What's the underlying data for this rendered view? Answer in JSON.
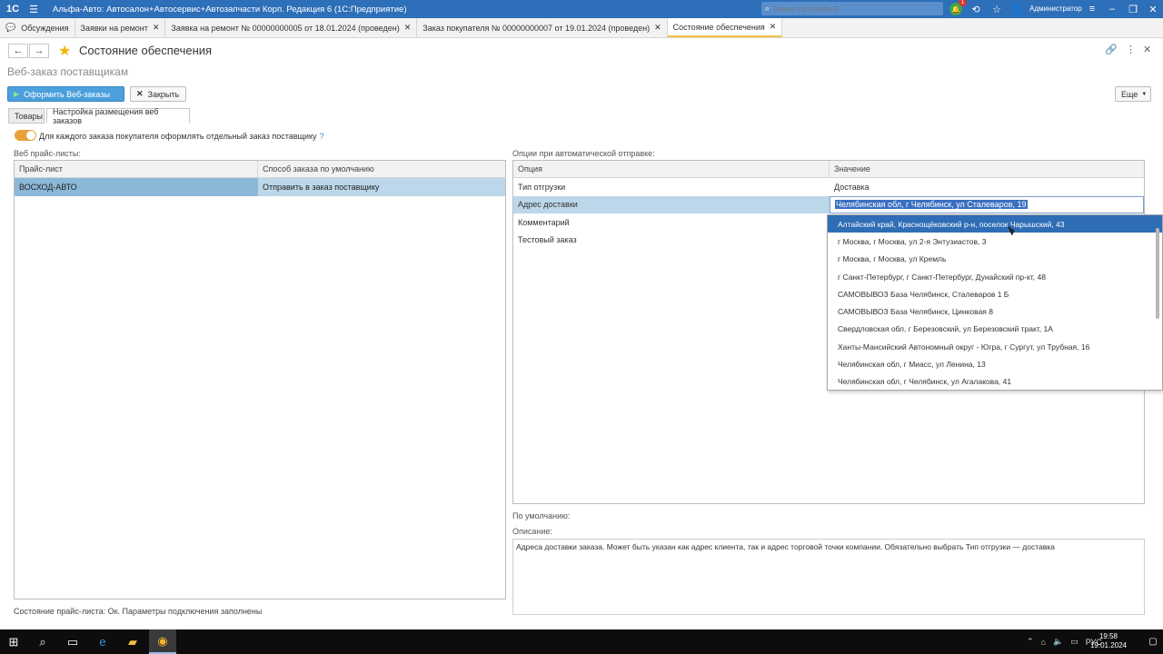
{
  "titlebar": {
    "logo": "1C",
    "title": "Альфа-Авто: Автосалон+Автосервис+Автозапчасти Корп. Редакция 6 (1С:Предприятие)",
    "search_placeholder": "Поиск Ctrl+Shift+F",
    "notification_count": "1",
    "user": "Администратор"
  },
  "open_tabs": [
    {
      "label": "Обсуждения"
    },
    {
      "label": "Заявки на ремонт"
    },
    {
      "label": "Заявка на ремонт № 00000000005 от 18.01.2024 (проведен)"
    },
    {
      "label": "Заказ покупателя № 00000000007 от 19.01.2024 (проведен)"
    },
    {
      "label": "Состояние обеспечения"
    }
  ],
  "form": {
    "title": "Состояние обеспечения",
    "subtitle": "Веб-заказ поставщикам",
    "btn_submit": "Оформить Веб-заказы",
    "btn_close": "Закрыть",
    "btn_more": "Еще",
    "tabs": [
      "Товары",
      "Настройка размещения веб заказов"
    ],
    "checkbox_label": "Для каждого заказа покупателя оформлять отдельный заказ поставщику",
    "help": "?"
  },
  "pricelists": {
    "label": "Веб прайс-листы:",
    "columns": [
      "Прайс-лист",
      "Способ заказа по умолчанию"
    ],
    "rows": [
      [
        "ВОСХОД-АВТО",
        "Отправить в заказ поставщику"
      ]
    ]
  },
  "options": {
    "label": "Опции при автоматической отправке:",
    "columns": [
      "Опция",
      "Значение"
    ],
    "rows": [
      {
        "option": "Тип отгрузки",
        "value": "Доставка"
      },
      {
        "option": "Адрес доставки",
        "value": "Челябинская обл, г Челябинск, ул Сталеваров, 19"
      },
      {
        "option": "Комментарий",
        "value": ""
      },
      {
        "option": "Тестовый заказ",
        "value": ""
      }
    ]
  },
  "dropdown": {
    "items": [
      "Алтайский край, Краснощёковский р-н, поселок Чарышский, 43",
      "г Москва, г Москва, ул 2-я Энтузиастов, 3",
      "г Москва, г Москва, ул Кремль",
      "г Санкт-Петербург, г Санкт-Петербург, Дунайский пр-кт, 48",
      "САМОВЫВОЗ База Челябинск, Сталеваров 1 Б",
      "САМОВЫВОЗ База Челябинск, Цинковая 8",
      "Свердловская обл, г Березовский, ул Березовский тракт, 1А",
      "Ханты-Мансийский Автономный округ - Югра, г Сургут, ул Трубная, 16",
      "Челябинская обл, г Миасс, ул Ленина, 13",
      "Челябинская обл, г Челябинск, ул Агалакова, 41"
    ]
  },
  "default_label": "По умолчанию:",
  "description": {
    "label": "Описание:",
    "text": "Адреса доставки заказа. Может быть указан как адрес клиента, так и адрес торговой точки компании. Обязательно выбрать Тип отгрузки — доставка"
  },
  "status": "Состояние прайс-листа: Ок. Параметры подключения заполнены",
  "taskbar": {
    "lang": "РУС",
    "time": "19:58",
    "date": "19.01.2024"
  }
}
